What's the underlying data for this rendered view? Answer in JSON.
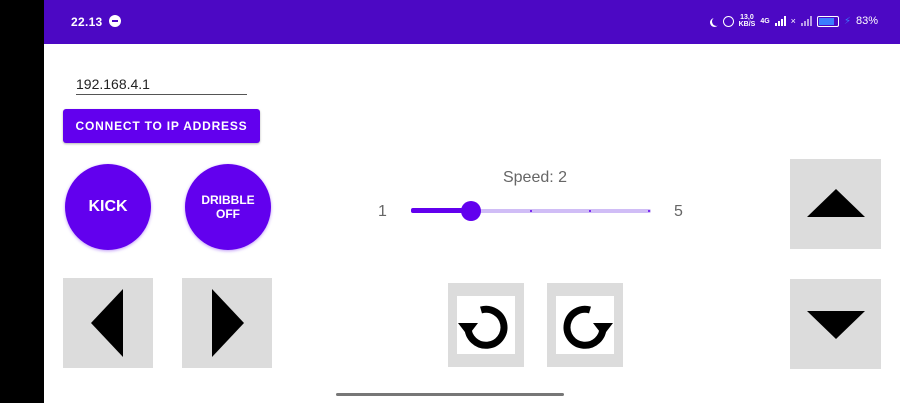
{
  "status_bar": {
    "time": "22.13",
    "net_speed_value": "13,0",
    "net_speed_unit": "KB/S",
    "network_type": "4G",
    "battery": "83%"
  },
  "connection": {
    "ip_value": "192.168.4.1",
    "connect_label": "CONNECT TO IP ADDRESS"
  },
  "actions": {
    "kick_label": "KICK",
    "dribble_line1": "DRIBBLE",
    "dribble_line2": "OFF"
  },
  "speed": {
    "label": "Speed: 2",
    "min": "1",
    "max": "5",
    "value": 2
  },
  "controls": {
    "left": "arrow-left-icon",
    "right": "arrow-right-icon",
    "up": "arrow-up-icon",
    "down": "arrow-down-icon",
    "rotate_ccw": "rotate-ccw-icon",
    "rotate_cw": "rotate-cw-icon"
  },
  "colors": {
    "status_bar": "#4c08c4",
    "accent": "#6200ee",
    "control_bg": "#dcdcdc"
  }
}
